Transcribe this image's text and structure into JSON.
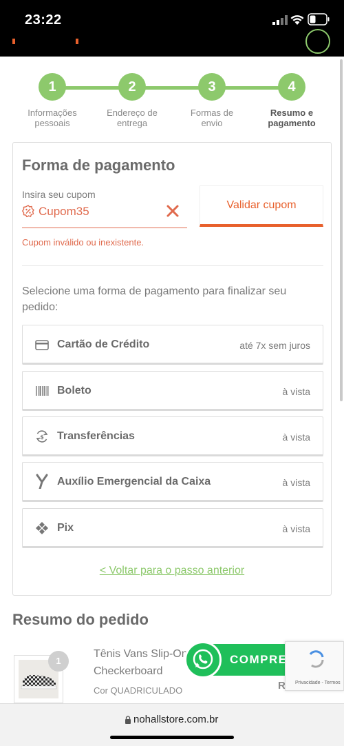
{
  "status_bar": {
    "time": "23:22"
  },
  "steps": [
    {
      "number": "1",
      "label_line1": "Informações",
      "label_line2": "pessoais",
      "active": false
    },
    {
      "number": "2",
      "label_line1": "Endereço de",
      "label_line2": "entrega",
      "active": false
    },
    {
      "number": "3",
      "label_line1": "Formas de",
      "label_line2": "envio",
      "active": false
    },
    {
      "number": "4",
      "label_line1": "Resumo e",
      "label_line2": "pagamento",
      "active": true
    }
  ],
  "payment": {
    "title": "Forma de pagamento",
    "coupon_label": "Insira seu cupom",
    "coupon_value": "Cupom35",
    "validate_label": "Validar cupom",
    "coupon_error": "Cupom inválido ou inexistente.",
    "select_text": "Selecione uma forma de pagamento para finalizar seu pedido:",
    "options": [
      {
        "icon": "credit-card-icon",
        "name": "Cartão de Crédito",
        "term": "até 7x sem juros"
      },
      {
        "icon": "barcode-icon",
        "name": "Boleto",
        "term": "à vista"
      },
      {
        "icon": "transfer-icon",
        "name": "Transferências",
        "term": "à vista"
      },
      {
        "icon": "caixa-logo-icon",
        "name": "Auxílio Emergencial da Caixa",
        "term": "à vista"
      },
      {
        "icon": "pix-icon",
        "name": "Pix",
        "term": "à vista"
      }
    ],
    "back_link": "< Voltar para o passo anterior"
  },
  "summary": {
    "title": "Resumo do pedido",
    "product": {
      "quantity": "1",
      "name_line1": "Tênis Vans Slip-On",
      "name_line2": "Checkerboard",
      "color": "Cor QUADRICULADO",
      "price_fragment": "R"
    }
  },
  "whatsapp": {
    "label": "COMPRE AQUI"
  },
  "recaptcha": {
    "text": "Privacidade - Termos"
  },
  "browser": {
    "url": "nohallstore.com.br"
  },
  "colors": {
    "accent_green": "#8dc96c",
    "accent_orange": "#e8602c",
    "error_red": "#e06a4d",
    "whatsapp_green": "#1fbf5a"
  }
}
